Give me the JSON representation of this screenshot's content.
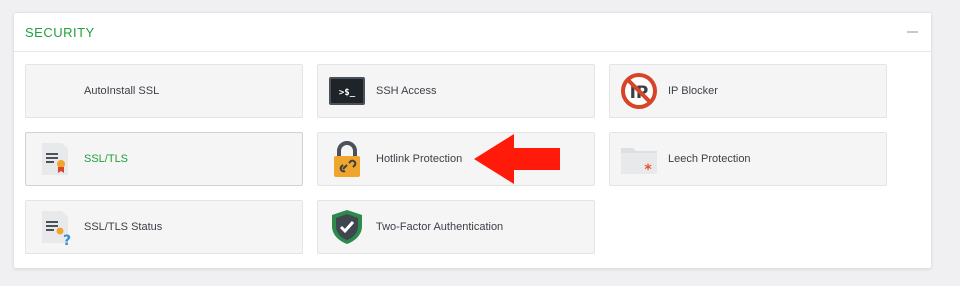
{
  "section": {
    "title": "SECURITY",
    "collapse_symbol": ""
  },
  "items": [
    {
      "label": "AutoInstall SSL",
      "icon": "none"
    },
    {
      "label": "SSH Access",
      "icon": "terminal-icon",
      "icon_text": ">$_"
    },
    {
      "label": "IP Blocker",
      "icon": "ip-blocker-icon",
      "icon_text": "IP"
    },
    {
      "label": "SSL/TLS",
      "icon": "ssl-certificate-icon",
      "active": true
    },
    {
      "label": "Hotlink Protection",
      "icon": "padlock-icon"
    },
    {
      "label": "Leech Protection",
      "icon": "folder-icon"
    },
    {
      "label": "SSL/TLS Status",
      "icon": "ssl-status-icon"
    },
    {
      "label": "Two-Factor Authentication",
      "icon": "shield-check-icon"
    }
  ],
  "annotation": {
    "icon": "red-arrow-icon",
    "color": "#ff1a0a"
  },
  "colors": {
    "accent": "#1fa13a",
    "label": "#3d4147",
    "tile_bg": "#f5f5f6"
  }
}
